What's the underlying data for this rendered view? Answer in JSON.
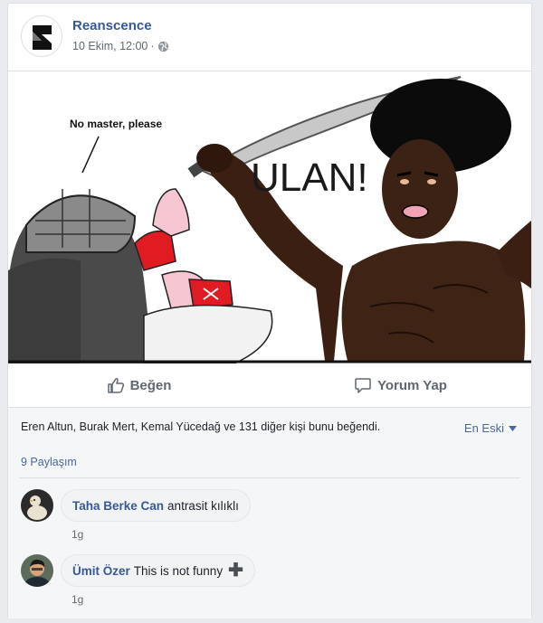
{
  "post": {
    "page_name": "Reanscence",
    "timestamp": "10 Ekim, 12:00",
    "separator": "·",
    "privacy_icon": "globe-icon"
  },
  "image": {
    "speech_text": "No master, please",
    "shout_text": "ULAN!"
  },
  "actions": {
    "like_label": "Beğen",
    "like_icon": "thumbs-up-icon",
    "comment_label": "Yorum Yap",
    "comment_icon": "speech-bubble-icon"
  },
  "reactions": {
    "likes_text": "Eren Altun, Burak Mert, Kemal Yücedağ ve 131 diğer kişi bunu beğendi.",
    "sort_label": "En Eski",
    "shares_text": "9 Paylaşım"
  },
  "comments": [
    {
      "author": "Taha Berke Can",
      "text": "antrasit kılıklı",
      "time": "1g",
      "avatar_icon": "duck-avatar"
    },
    {
      "author": "Ümit Özer",
      "text": "This is not funny",
      "time": "1g",
      "avatar_icon": "person-avatar",
      "extra_icon": "plus-icon"
    }
  ],
  "colors": {
    "link_blue": "#365899",
    "muted_gray": "#616770",
    "card_bg": "#ffffff",
    "page_bg": "#e9ebee"
  }
}
